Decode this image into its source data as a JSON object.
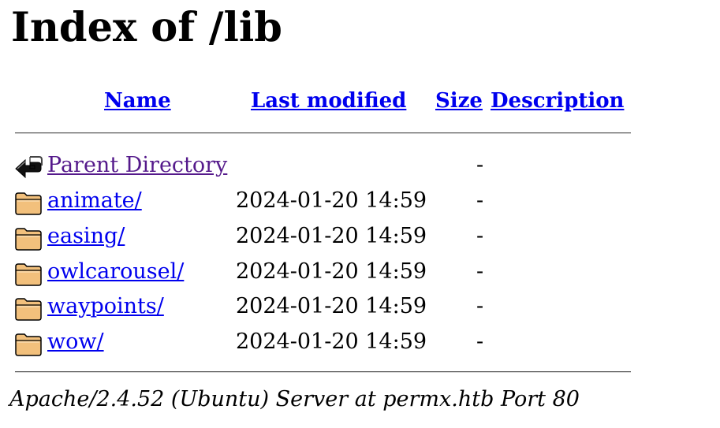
{
  "page": {
    "title": "Index of /lib"
  },
  "columns": {
    "name": "Name",
    "last_modified": "Last modified",
    "size": "Size",
    "description": "Description"
  },
  "parent": {
    "label": "Parent Directory",
    "size": "-",
    "icon": "back-arrow-icon"
  },
  "entries": [
    {
      "name": "animate/",
      "modified": "2024-01-20 14:59",
      "size": "-",
      "icon": "folder-icon"
    },
    {
      "name": "easing/",
      "modified": "2024-01-20 14:59",
      "size": "-",
      "icon": "folder-icon"
    },
    {
      "name": "owlcarousel/",
      "modified": "2024-01-20 14:59",
      "size": "-",
      "icon": "folder-icon"
    },
    {
      "name": "waypoints/",
      "modified": "2024-01-20 14:59",
      "size": "-",
      "icon": "folder-icon"
    },
    {
      "name": "wow/",
      "modified": "2024-01-20 14:59",
      "size": "-",
      "icon": "folder-icon"
    }
  ],
  "footer": {
    "server": "Apache/2.4.52 (Ubuntu) Server at permx.htb Port 80"
  },
  "colors": {
    "link": "#0000ee",
    "visited_link": "#551a8b",
    "folder_fill": "#f2c07c",
    "folder_stroke": "#000000"
  }
}
